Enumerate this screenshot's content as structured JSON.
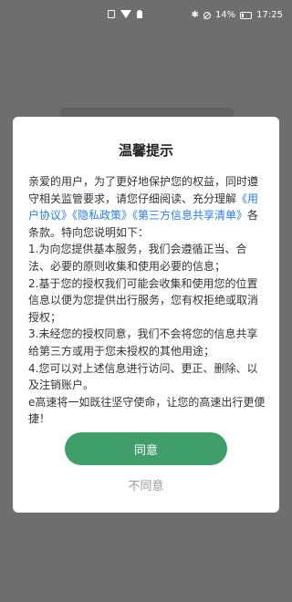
{
  "status_bar": {
    "battery": "14%",
    "time": "17:25"
  },
  "dialog": {
    "title": "温馨提示",
    "intro_before": "亲爱的用户，为了更好地保护您的权益，同时遵守相关监管要求，请您仔细阅读、充分理解",
    "link_user_agreement": "《用户协议》",
    "link_privacy_policy": "《隐私政策》",
    "link_third_party_list": "《第三方信息共享清单》",
    "intro_after": "各条款。特向您说明如下：",
    "item1": "1.为向您提供基本服务，我们会遵循正当、合法、必要的原则收集和使用必要的信息；",
    "item2": "2.基于您的授权我们可能会收集和使用您的位置信息以便为您提供出行服务，您有权拒绝或取消授权；",
    "item3": "3.未经您的授权同意，我们不会将您的信息共享给第三方或用于您未授权的其他用途；",
    "item4": "4.您可以对上述信息进行访问、更正、删除、以及注销账户。",
    "closing": "e高速将一如既往坚守使命，让您的高速出行更便捷！",
    "agree_label": "同意",
    "disagree_label": "不同意"
  },
  "colors": {
    "accent": "#3f9e69",
    "link": "#2a7fd6",
    "overlay": "#6e6e6e"
  }
}
